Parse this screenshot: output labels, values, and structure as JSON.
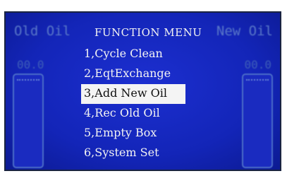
{
  "screen": {
    "title": "FUNCTION MENU",
    "left_tag": "Old Oil",
    "right_tag": "New Oil",
    "left_level": "00.0",
    "right_level": "00.0",
    "selected_index": 2,
    "items": [
      {
        "label": "1,Cycle Clean"
      },
      {
        "label": "2,EqtExchange"
      },
      {
        "label": "3,Add New Oil"
      },
      {
        "label": "4,Rec Old Oil"
      },
      {
        "label": "5,Empty Box"
      },
      {
        "label": "6,System Set"
      }
    ]
  },
  "colors": {
    "background": "#1325b8",
    "text": "#f3f3f3",
    "highlight_bg": "#f4f4f4",
    "highlight_text": "#101010"
  }
}
